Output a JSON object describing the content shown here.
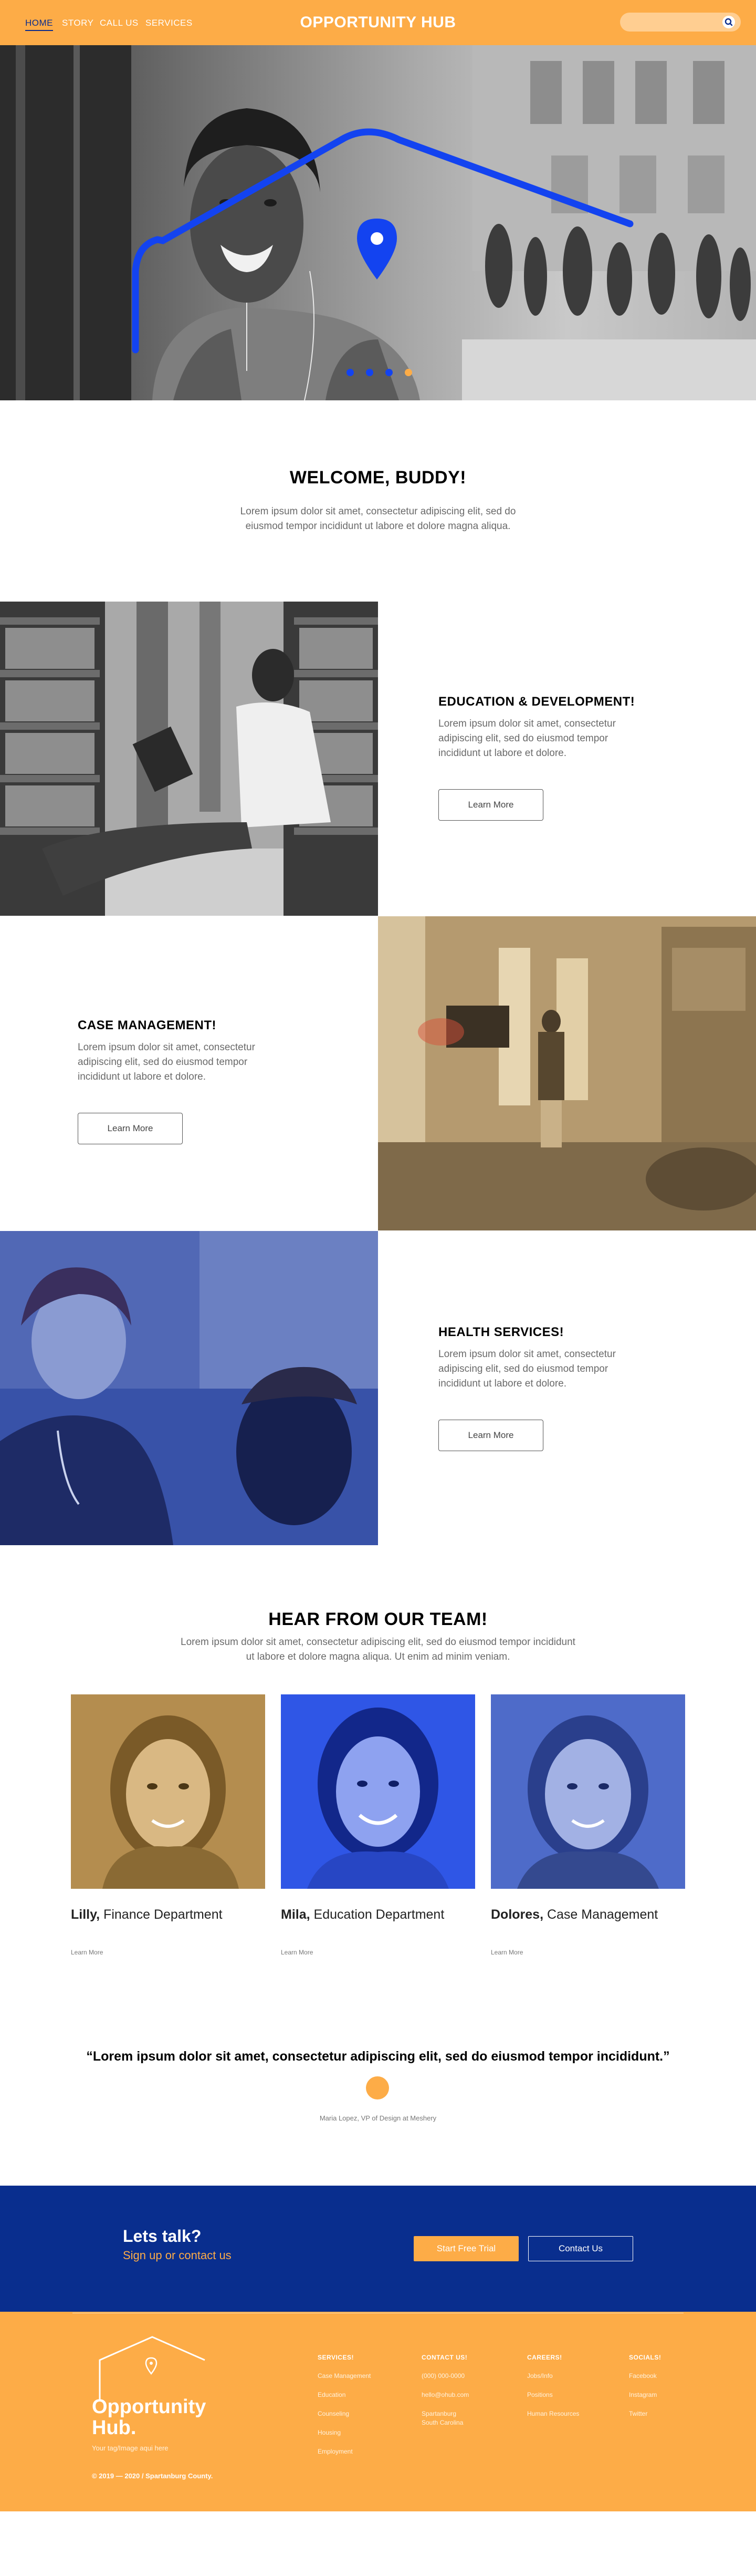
{
  "colors": {
    "orange": "#fdac47",
    "blue": "#0b2c8c",
    "navy": "#092e8e",
    "pin": "#1343f0"
  },
  "nav": {
    "home": "HOME",
    "story": "STORY",
    "call": "CALL US",
    "services": "SERVICES"
  },
  "brand": {
    "title": "OPPORTUNITY HUB"
  },
  "search": {
    "placeholder": "",
    "icon": "search-icon"
  },
  "welcome": {
    "title": "WELCOME,  BUDDY!",
    "line1": "Lorem ipsum dolor sit amet, consectetur adipiscing elit, sed do",
    "line2": "eiusmod tempor incididunt ut labore et dolore magna aliqua."
  },
  "services": [
    {
      "title": "EDUCATION & DEVELOPMENT!",
      "line1": "Lorem ipsum dolor sit amet, consectetur",
      "line2": "adipiscing elit, sed do eiusmod tempor",
      "line3": "incididunt ut labore et dolore.",
      "button": "Learn More"
    },
    {
      "title": "CASE MANAGEMENT!",
      "line1": "Lorem ipsum dolor sit amet, consectetur",
      "line2": "adipiscing elit, sed do eiusmod tempor",
      "line3": "incididunt ut labore et dolore.",
      "button": "Learn More"
    },
    {
      "title": "HEALTH SERVICES!",
      "line1": "Lorem ipsum dolor sit amet, consectetur",
      "line2": "adipiscing elit, sed do eiusmod tempor",
      "line3": "incididunt ut labore et dolore.",
      "button": "Learn More"
    }
  ],
  "team": {
    "title": "HEAR FROM OUR TEAM!",
    "line1": "Lorem ipsum dolor sit amet, consectetur adipiscing elit, sed do eiusmod tempor incididunt",
    "line2": "ut labore et dolore magna aliqua. Ut enim ad minim veniam.",
    "members": [
      {
        "name": "Lilly,",
        "dept": " Finance Department",
        "link": "Learn More"
      },
      {
        "name": "Mila,",
        "dept": " Education Department",
        "link": "Learn More"
      },
      {
        "name": "Dolores,",
        "dept": " Case Management",
        "link": "Learn More"
      }
    ]
  },
  "quote": {
    "text": "“Lorem ipsum dolor sit amet, consectetur adipiscing elit, sed do eiusmod tempor incididunt.”",
    "author": "Maria Lopez, VP of Design at Meshery"
  },
  "cta": {
    "title": "Lets talk?",
    "subtitle": "Sign up or contact us",
    "primary": "Start Free Trial",
    "secondary": "Contact Us"
  },
  "footer": {
    "logo_line1": "Opportunity",
    "logo_line2": "Hub.",
    "tagline": "Your tag/Image aqui here",
    "copyright": "© 2019 — 2020 / Spartanburg County.",
    "columns": [
      {
        "head": "SERVICES!",
        "items": [
          "Case Management",
          "Education",
          "Counseling",
          "Housing",
          "Employment"
        ]
      },
      {
        "head": "CONTACT US!",
        "items": [
          "(000) 000-0000",
          "hello@ohub.com",
          "Spartanburg",
          "South Carolina"
        ]
      },
      {
        "head": "CAREERS!",
        "items": [
          "Jobs/Info",
          "Positions",
          "Human Resources"
        ]
      },
      {
        "head": "SOCIALS!",
        "items": [
          "Facebook",
          "Instagram",
          "Twitter"
        ]
      }
    ]
  }
}
